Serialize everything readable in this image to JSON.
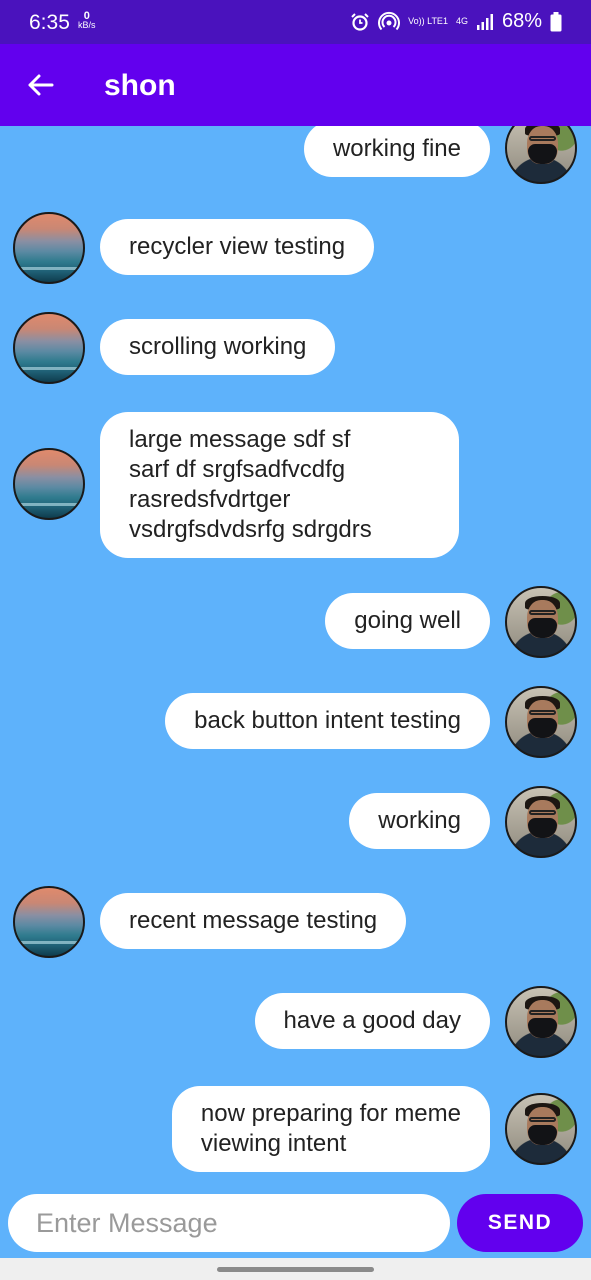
{
  "status_bar": {
    "time": "6:35",
    "net_speed_value": "0",
    "net_speed_unit": "kB/s",
    "volte_label": "Vo)) LTE1",
    "network_type": "4G",
    "battery_percent": "68%"
  },
  "app_bar": {
    "title": "shon"
  },
  "messages": [
    {
      "side": "sent",
      "text": "working fine"
    },
    {
      "side": "received",
      "text": "recycler view testing"
    },
    {
      "side": "received",
      "text": "scrolling working"
    },
    {
      "side": "received",
      "text": "large message sdf sf\nsarf df srgfsadfvcdfg\nrasredsfvdrtger\nvsdrgfsdvdsrfg sdrgdrs"
    },
    {
      "side": "sent",
      "text": "going well"
    },
    {
      "side": "sent",
      "text": "back button intent testing"
    },
    {
      "side": "sent",
      "text": "working"
    },
    {
      "side": "received",
      "text": "recent message testing"
    },
    {
      "side": "sent",
      "text": "have a good day"
    },
    {
      "side": "sent",
      "text": "now preparing for meme\nviewing intent"
    }
  ],
  "composer": {
    "placeholder": "Enter Message",
    "value": "",
    "send_label": "SEND"
  },
  "colors": {
    "status_bar": "#4a12bd",
    "app_bar": "#6200ee",
    "chat_background": "#5eb2fb",
    "bubble": "#ffffff",
    "send_button": "#6200ee"
  }
}
